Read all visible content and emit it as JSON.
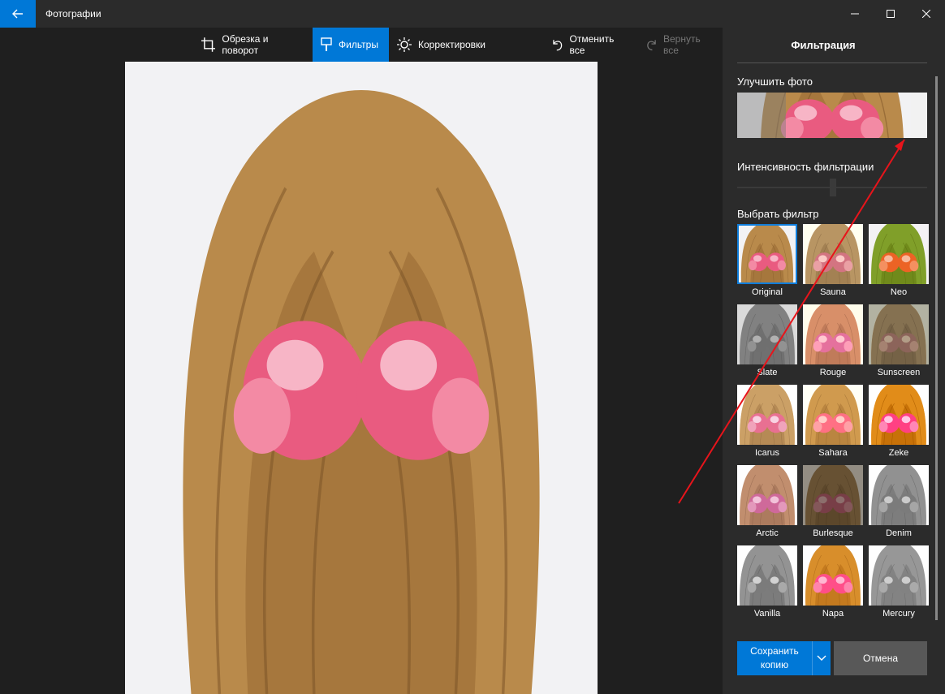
{
  "window": {
    "app_title": "Фотографии",
    "controls": [
      "minimize-icon",
      "maximize-icon",
      "close-icon"
    ]
  },
  "toolbar": {
    "crop": "Обрезка и поворот",
    "filters": "Фильтры",
    "adjust": "Корректировки",
    "undo_all": "Отменить все",
    "redo_all": "Вернуть все"
  },
  "panel": {
    "title": "Фильтрация",
    "enhance_label": "Улучшить фото",
    "intensity_label": "Интенсивность фильтрации",
    "choose_label": "Выбрать фильтр",
    "filters": [
      {
        "name": "Original",
        "selected": true
      },
      {
        "name": "Sauna"
      },
      {
        "name": "Neo"
      },
      {
        "name": "Slate"
      },
      {
        "name": "Rouge"
      },
      {
        "name": "Sunscreen"
      },
      {
        "name": "Icarus"
      },
      {
        "name": "Sahara"
      },
      {
        "name": "Zeke"
      },
      {
        "name": "Arctic"
      },
      {
        "name": "Burlesque"
      },
      {
        "name": "Denim"
      },
      {
        "name": "Vanilla"
      },
      {
        "name": "Napa"
      },
      {
        "name": "Mercury"
      }
    ],
    "save_label_1": "Сохранить",
    "save_label_2": "копию",
    "cancel_label": "Отмена"
  },
  "colors": {
    "accent": "#0078d7",
    "panel_bg": "#2b2b2b",
    "app_bg": "#1f1f1f",
    "annotation_arrow": "#e8141b"
  }
}
